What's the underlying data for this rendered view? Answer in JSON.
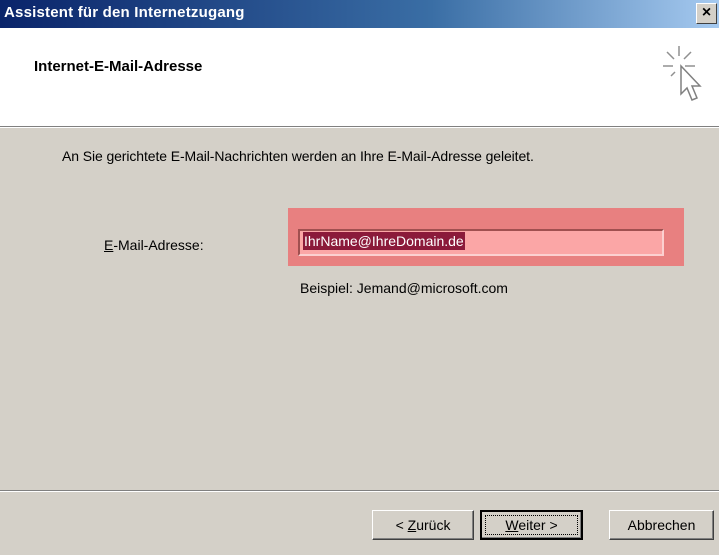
{
  "window": {
    "title": "Assistent für den Internetzugang",
    "close_glyph": "×"
  },
  "header": {
    "title": "Internet-E-Mail-Adresse",
    "icon": "wizard-cursor-sparkle-icon"
  },
  "body": {
    "intro": "An Sie gerichtete E-Mail-Nachrichten werden an Ihre E-Mail-Adresse geleitet.",
    "email_label_accel": "E",
    "email_label_rest": "-Mail-Adresse:",
    "email_value": "IhrName@IhreDomain.de",
    "example": "Beispiel: Jemand@microsoft.com"
  },
  "footer": {
    "back_prefix": "< ",
    "back_accel": "Z",
    "back_rest": "urück",
    "next_accel": "W",
    "next_rest": "eiter >",
    "cancel_label": "Abbrechen"
  },
  "colors": {
    "titlebar_start": "#0a246a",
    "titlebar_end": "#a6caf0",
    "dialog_bg": "#d4d0c8",
    "highlight": "#e88080",
    "selection": "#8b1a3a"
  }
}
